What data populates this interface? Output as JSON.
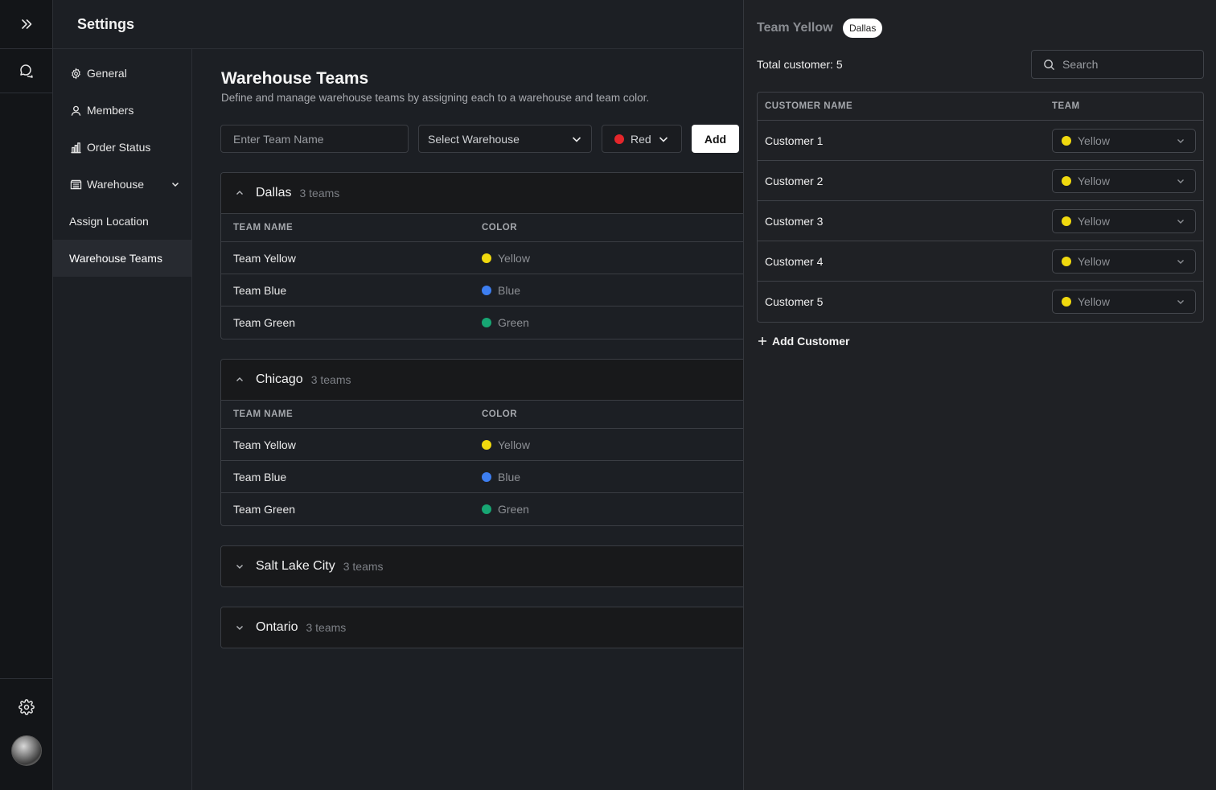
{
  "header": {
    "title": "Settings"
  },
  "nav": {
    "items": [
      {
        "label": "General",
        "icon": "gear-icon"
      },
      {
        "label": "Members",
        "icon": "user-icon"
      },
      {
        "label": "Order Status",
        "icon": "bar-chart-icon"
      },
      {
        "label": "Warehouse",
        "icon": "warehouse-icon"
      },
      {
        "label": "Assign Location"
      },
      {
        "label": "Warehouse Teams"
      }
    ],
    "active": "Warehouse Teams"
  },
  "main": {
    "title": "Warehouse Teams",
    "description": "Define and manage warehouse teams by assigning each to a warehouse and team color.",
    "form": {
      "team_name_placeholder": "Enter Team Name",
      "warehouse_placeholder": "Select Warehouse",
      "color_value": "Red",
      "color_hex": "#e5262b",
      "add_label": "Add"
    },
    "columns": {
      "team_name": "TEAM NAME",
      "color": "COLOR"
    },
    "groups": [
      {
        "city": "Dallas",
        "count": "3 teams",
        "expanded": true,
        "teams": [
          {
            "name": "Team Yellow",
            "color": "Yellow",
            "hex": "#f0d90e"
          },
          {
            "name": "Team Blue",
            "color": "Blue",
            "hex": "#3d7ef0"
          },
          {
            "name": "Team Green",
            "color": "Green",
            "hex": "#17a673"
          }
        ]
      },
      {
        "city": "Chicago",
        "count": "3 teams",
        "expanded": true,
        "teams": [
          {
            "name": "Team Yellow",
            "color": "Yellow",
            "hex": "#f0d90e"
          },
          {
            "name": "Team Blue",
            "color": "Blue",
            "hex": "#3d7ef0"
          },
          {
            "name": "Team Green",
            "color": "Green",
            "hex": "#17a673"
          }
        ]
      },
      {
        "city": "Salt Lake City",
        "count": "3 teams",
        "expanded": false
      },
      {
        "city": "Ontario",
        "count": "3 teams",
        "expanded": false
      }
    ]
  },
  "panel": {
    "title": "Team Yellow",
    "badge": "Dallas",
    "total": "Total customer: 5",
    "search_placeholder": "Search",
    "columns": {
      "customer_name": "CUSTOMER NAME",
      "team": "TEAM"
    },
    "customers": [
      {
        "name": "Customer 1",
        "team": "Yellow",
        "hex": "#f0d90e"
      },
      {
        "name": "Customer 2",
        "team": "Yellow",
        "hex": "#f0d90e"
      },
      {
        "name": "Customer 3",
        "team": "Yellow",
        "hex": "#f0d90e"
      },
      {
        "name": "Customer 4",
        "team": "Yellow",
        "hex": "#f0d90e"
      },
      {
        "name": "Customer 5",
        "team": "Yellow",
        "hex": "#f0d90e"
      }
    ],
    "add_customer_label": "Add Customer"
  }
}
